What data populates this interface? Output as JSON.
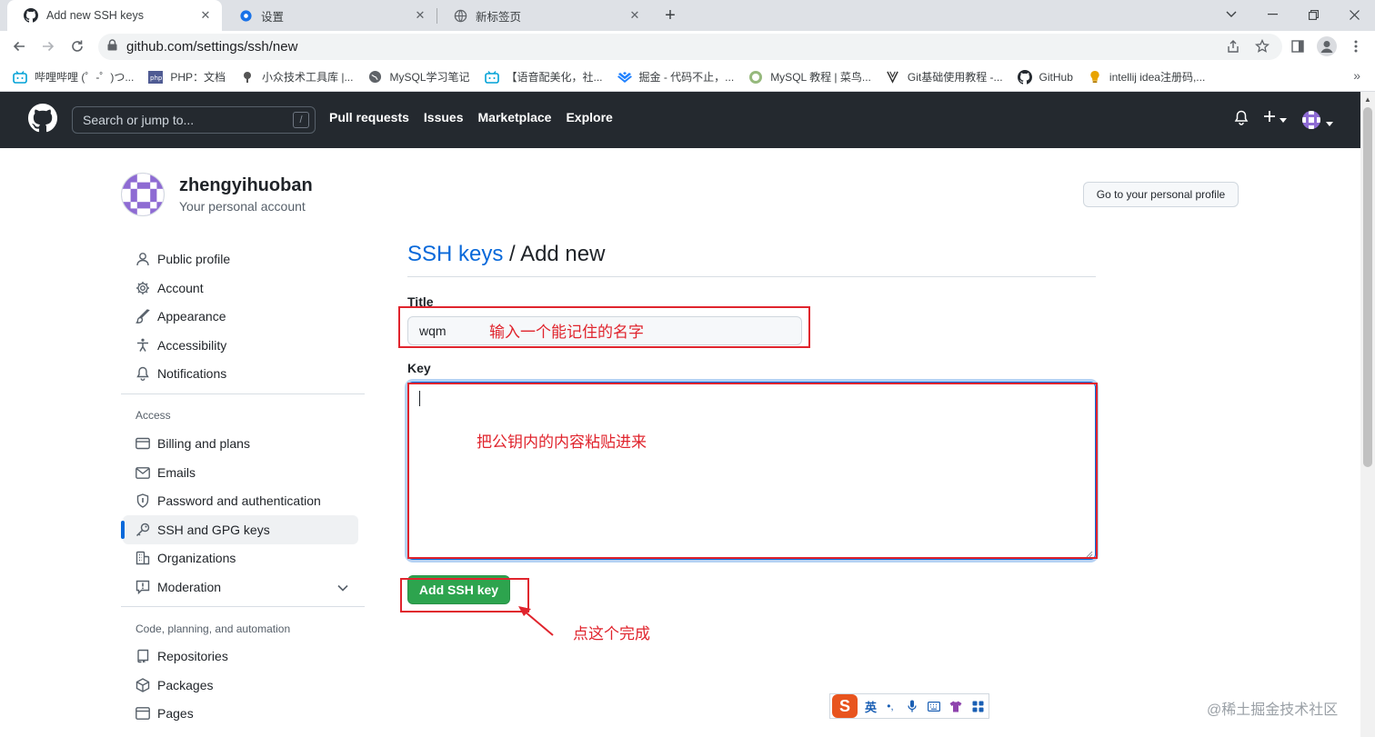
{
  "browser": {
    "tabs": [
      {
        "title": "Add new SSH keys",
        "icon": "github-icon"
      },
      {
        "title": "设置",
        "icon": "gear-icon"
      },
      {
        "title": "新标签页",
        "icon": "globe-icon"
      }
    ],
    "url": "github.com/settings/ssh/new",
    "bookmarks": [
      "哔哩哔哩 (゜-゜)つ...",
      "PHP：文档",
      "小众技术工具库 |...",
      "MySQL学习笔记",
      "【语音配美化，社...",
      "掘金 - 代码不止，...",
      "MySQL 教程 | 菜鸟...",
      "Git基础使用教程 -...",
      "GitHub",
      "intellij idea注册码,..."
    ],
    "bookmarks_more": "»"
  },
  "gh": {
    "search_placeholder": "Search or jump to...",
    "search_shortcut": "/",
    "nav": [
      "Pull requests",
      "Issues",
      "Marketplace",
      "Explore"
    ]
  },
  "account": {
    "name": "zhengyihuoban",
    "subtitle": "Your personal account",
    "profile_button": "Go to your personal profile"
  },
  "sidebar": {
    "items_top": [
      {
        "label": "Public profile",
        "icon": "person-icon"
      },
      {
        "label": "Account",
        "icon": "gear-icon"
      },
      {
        "label": "Appearance",
        "icon": "paintbrush-icon"
      },
      {
        "label": "Accessibility",
        "icon": "accessibility-icon"
      },
      {
        "label": "Notifications",
        "icon": "bell-icon"
      }
    ],
    "access_heading": "Access",
    "items_access": [
      {
        "label": "Billing and plans",
        "icon": "credit-card-icon"
      },
      {
        "label": "Emails",
        "icon": "mail-icon"
      },
      {
        "label": "Password and authentication",
        "icon": "shield-lock-icon"
      },
      {
        "label": "SSH and GPG keys",
        "icon": "key-icon",
        "selected": true
      },
      {
        "label": "Organizations",
        "icon": "organization-icon"
      },
      {
        "label": "Moderation",
        "icon": "report-icon"
      }
    ],
    "code_heading": "Code, planning, and automation",
    "items_code": [
      {
        "label": "Repositories",
        "icon": "repo-icon"
      },
      {
        "label": "Packages",
        "icon": "package-icon"
      },
      {
        "label": "Pages",
        "icon": "browser-icon"
      }
    ]
  },
  "form": {
    "breadcrumb_link": "SSH keys",
    "breadcrumb_sep": " / ",
    "breadcrumb_current": "Add new",
    "title_label": "Title",
    "title_value": "wqm",
    "key_label": "Key",
    "key_value": "",
    "submit_label": "Add SSH key"
  },
  "annotations": {
    "title_note": "输入一个能记住的名字",
    "key_note": "把公钥内的内容粘贴进来",
    "button_note": "点这个完成",
    "color": "#e0242d"
  },
  "ime": {
    "lang": "英"
  },
  "watermark": "@稀土掘金技术社区",
  "colors": {
    "header_bg": "#24292f",
    "link_blue": "#0969da",
    "primary_green": "#2da44e"
  }
}
